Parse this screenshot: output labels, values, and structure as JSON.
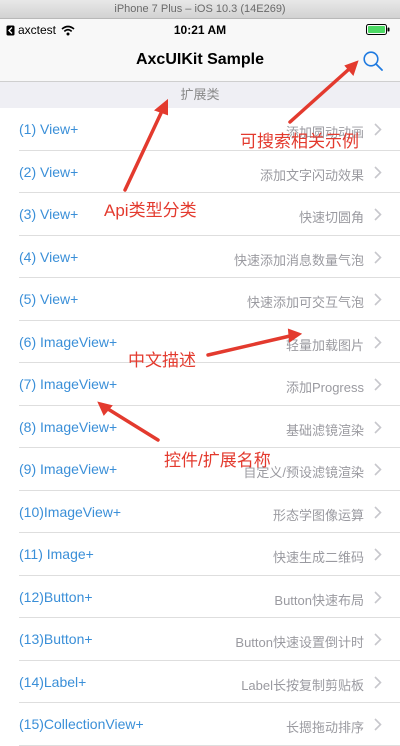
{
  "simulator": {
    "title": "iPhone 7 Plus – iOS 10.3 (14E269)"
  },
  "status": {
    "carrier": "axctest",
    "time": "10:21 AM"
  },
  "nav": {
    "title": "AxcUIKit Sample"
  },
  "section": {
    "title": "扩展类"
  },
  "rows": [
    {
      "title": "(1)  View+",
      "desc": "添加圆动动画"
    },
    {
      "title": "(2)  View+",
      "desc": "添加文字闪动效果"
    },
    {
      "title": "(3)  View+",
      "desc": "快速切圆角"
    },
    {
      "title": "(4)  View+",
      "desc": "快速添加消息数量气泡"
    },
    {
      "title": "(5)  View+",
      "desc": "快速添加可交互气泡"
    },
    {
      "title": "(6)  ImageView+",
      "desc": "轻量加载图片"
    },
    {
      "title": "(7)  ImageView+",
      "desc": "添加Progress"
    },
    {
      "title": "(8)  ImageView+",
      "desc": "基础滤镜渲染"
    },
    {
      "title": "(9)  ImageView+",
      "desc": "自定义/预设滤镜渲染"
    },
    {
      "title": "(10)ImageView+",
      "desc": "形态学图像运算"
    },
    {
      "title": "(11)  Image+",
      "desc": "快速生成二维码"
    },
    {
      "title": "(12)Button+",
      "desc": "Button快速布局"
    },
    {
      "title": "(13)Button+",
      "desc": "Button快速设置倒计时"
    },
    {
      "title": "(14)Label+",
      "desc": "Label长按复制剪贴板"
    },
    {
      "title": "(15)CollectionView+",
      "desc": "长摁拖动排序"
    }
  ],
  "annotations": {
    "search": "可搜索相关示例",
    "api_category": "Api类型分类",
    "chinese_desc": "中文描述",
    "control_name": "控件/扩展名称"
  },
  "colors": {
    "accent": "#3a8fd8",
    "annotation": "#e33a2e",
    "secondary_text": "#9a9aa0"
  },
  "icons": [
    "back-icon",
    "wifi-icon",
    "battery-icon",
    "search-icon",
    "chevron-right-icon"
  ]
}
